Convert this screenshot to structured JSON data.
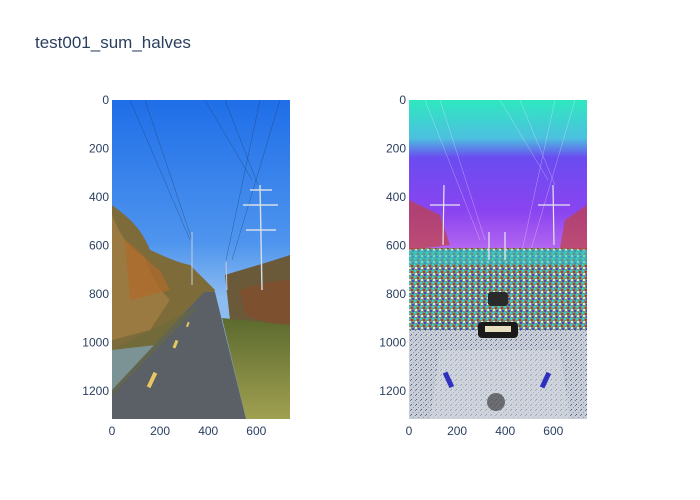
{
  "title": "test001_sum_halves",
  "chart_data": [
    {
      "type": "image",
      "panel": "left",
      "xlim": [
        0,
        740
      ],
      "ylim": [
        1316,
        0
      ],
      "x_ticks": [
        0,
        200,
        400,
        600
      ],
      "y_ticks": [
        0,
        200,
        400,
        600,
        800,
        1000,
        1200
      ],
      "colors": {
        "sky_top": "#1f6ee8",
        "sky_bottom": "#7fb4ef",
        "vegetation": "#7d6b3a",
        "path": "#5b6066",
        "grass": "#8a9a4a"
      }
    },
    {
      "type": "image",
      "panel": "right",
      "xlim": [
        0,
        740
      ],
      "ylim": [
        1316,
        0
      ],
      "x_ticks": [
        0,
        200,
        400,
        600
      ],
      "y_ticks": [
        0,
        200,
        400,
        600,
        800,
        1000,
        1200
      ],
      "colors": {
        "sky_top": "#2ee8c0",
        "sky_mid": "#7f3cf0",
        "sky_bottom": "#e8a0f0",
        "noise_a": "#2fd0d8",
        "noise_b": "#c03030",
        "path": "#c8ccd6"
      }
    }
  ]
}
